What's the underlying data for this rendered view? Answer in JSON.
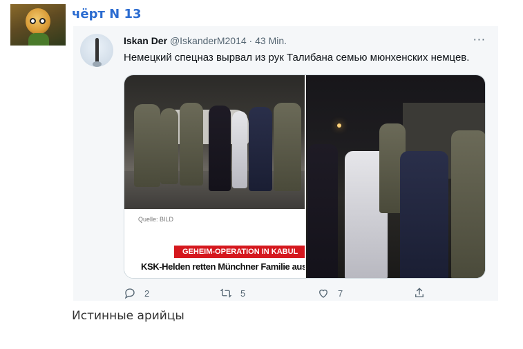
{
  "post": {
    "username": "чёрт N 13",
    "caption": "Истинные арийцы"
  },
  "tweet": {
    "name": "Iskan Der",
    "handle": "@IskanderM2014",
    "separator": "·",
    "time": "43 Min.",
    "more": "···",
    "text": "Немецкий спецназ вырвал из рук Талибана семью мюнхенских немцев.",
    "media": {
      "source": "Quelle: BILD",
      "banner": "GEHEIM-OPERATION IN KABUL",
      "headline": "KSK-Helden retten Münchner Familie aus Ta"
    },
    "actions": {
      "replies": "2",
      "retweets": "5",
      "likes": "7"
    }
  },
  "icons": {
    "reply": "reply-icon",
    "retweet": "retweet-icon",
    "like": "heart-icon",
    "share": "share-icon",
    "more": "more-icon"
  },
  "colors": {
    "username": "#2a6bd0",
    "tweet_bg": "#f5f7f9",
    "banner_red": "#d5181e",
    "secondary_text": "#536471"
  }
}
